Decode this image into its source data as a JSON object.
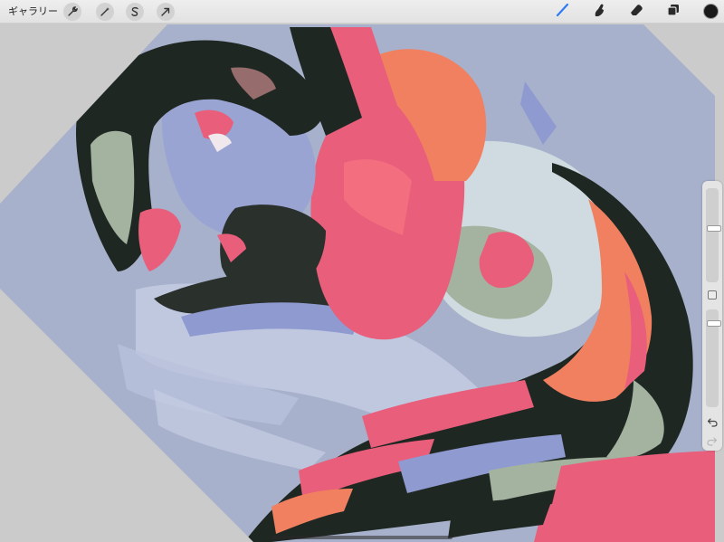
{
  "toolbar": {
    "gallery_label": "ギャラリー",
    "left_tools": [
      {
        "name": "actions",
        "icon": "wrench-icon"
      },
      {
        "name": "adjustments",
        "icon": "magic-wand-icon"
      },
      {
        "name": "selection",
        "icon": "selection-s-icon"
      },
      {
        "name": "transform",
        "icon": "arrow-cursor-icon"
      }
    ],
    "right_tools": [
      {
        "name": "brush",
        "icon": "brush-icon",
        "active": true
      },
      {
        "name": "smudge",
        "icon": "smudge-finger-icon",
        "active": false
      },
      {
        "name": "eraser",
        "icon": "eraser-icon",
        "active": false
      },
      {
        "name": "layers",
        "icon": "layers-icon",
        "active": false
      }
    ],
    "current_color": "#1a1a1a",
    "active_tool_color": "#2f7bf6"
  },
  "sidebar": {
    "brush_size_level": 0.58,
    "opacity_level": 0.12,
    "undo_icon": "undo-icon",
    "redo_icon": "redo-icon",
    "modify_icon": "square-modify-icon"
  },
  "colors": {
    "background_blue": "#a7b1cb",
    "pink": "#e85e7b",
    "orange": "#f08060",
    "dark": "#1f2723",
    "skin": "#9aa4d2",
    "sage": "#a4b3a0",
    "pale": "#cfdbe0"
  }
}
